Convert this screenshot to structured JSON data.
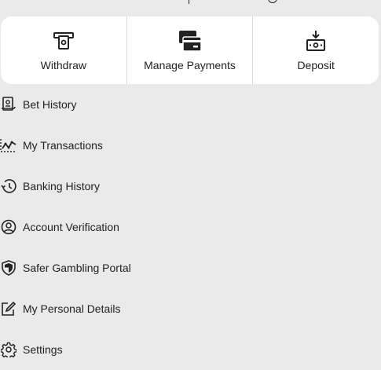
{
  "quick_actions": [
    {
      "label": "Withdraw",
      "icon": "atm-withdraw-icon"
    },
    {
      "label": "Manage Payments",
      "icon": "credit-card-icon"
    },
    {
      "label": "Deposit",
      "icon": "cash-deposit-icon"
    }
  ],
  "menu": [
    {
      "label": "Bet History",
      "icon": "receipt-icon"
    },
    {
      "label": "My Transactions",
      "icon": "transactions-chart-icon"
    },
    {
      "label": "Banking History",
      "icon": "history-clock-icon"
    },
    {
      "label": "Account Verification",
      "icon": "user-verification-icon"
    },
    {
      "label": "Safer Gambling Portal",
      "icon": "shield-icon"
    },
    {
      "label": "My Personal Details",
      "icon": "edit-icon"
    },
    {
      "label": "Settings",
      "icon": "gear-icon"
    }
  ]
}
